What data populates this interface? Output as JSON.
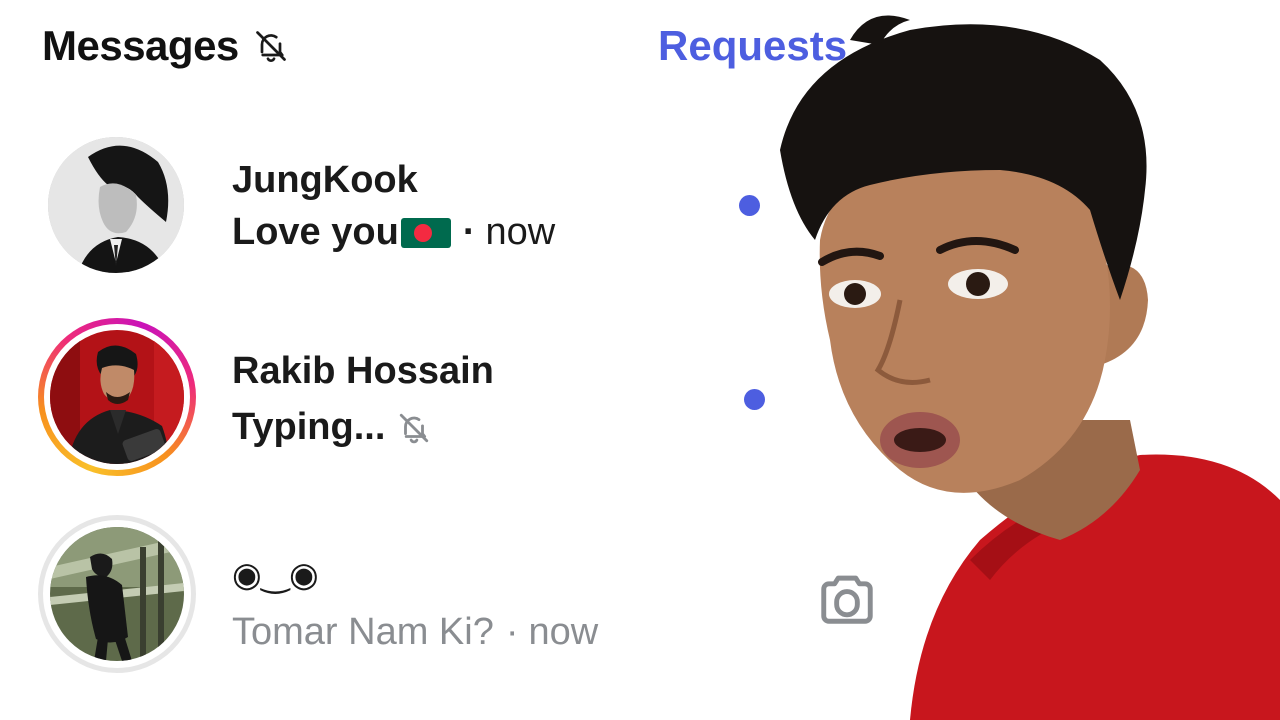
{
  "header": {
    "title": "Messages",
    "requests_label": "Requests"
  },
  "threads": [
    {
      "name": "JungKook",
      "message": "Love you",
      "flag": "bangladesh-flag",
      "separator": "·",
      "time": "now",
      "unread": true
    },
    {
      "name": "Rakib Hossain",
      "message": "Typing...",
      "muted": true,
      "unread": true,
      "has_story_ring": true
    },
    {
      "name": "◉‿◉",
      "message": "Tomar Nam Ki?",
      "separator": "·",
      "time": "now",
      "unread": false,
      "action_icon": "camera-icon"
    }
  ],
  "colors": {
    "accent": "#4d5ee0",
    "text_primary": "#1a1a1a",
    "text_secondary": "#8a8d91",
    "flag_green": "#006a4e",
    "flag_red": "#f42a41",
    "story_ring_start": "#f9c02a",
    "story_ring_end": "#c913b9"
  }
}
